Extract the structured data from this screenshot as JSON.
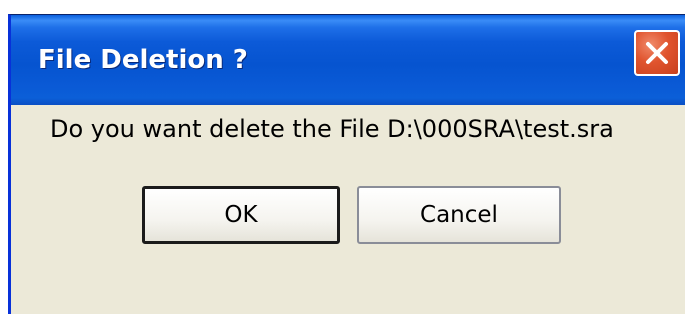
{
  "dialog": {
    "title": "File Deletion ?",
    "message": "Do you want delete the File D:\\000SRA\\test.sra",
    "close_icon": "close-x-icon",
    "buttons": {
      "ok_label": "OK",
      "cancel_label": "Cancel"
    }
  },
  "colors": {
    "titlebar": "#0654D0",
    "dialog_background": "#ECE9D8",
    "close_button": "#E0542E"
  }
}
